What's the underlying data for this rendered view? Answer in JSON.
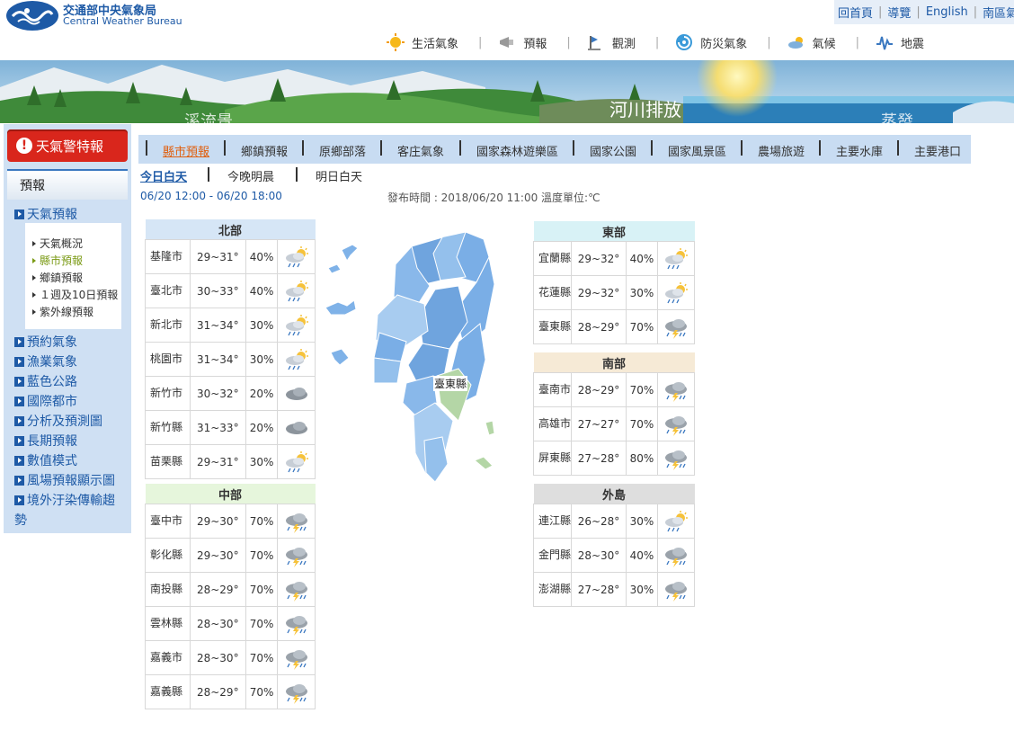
{
  "brand": {
    "cn": "交通部中央氣象局",
    "en": "Central Weather Bureau"
  },
  "top_links": [
    "回首頁",
    "導覽",
    "English",
    "南區氣"
  ],
  "main_nav": [
    {
      "label": "生活氣象",
      "icon": "sun-icon"
    },
    {
      "label": "預報",
      "icon": "megaphone-icon"
    },
    {
      "label": "觀測",
      "icon": "instrument-icon"
    },
    {
      "label": "防災氣象",
      "icon": "typhoon-icon"
    },
    {
      "label": "氣候",
      "icon": "cloud-sun-icon"
    },
    {
      "label": "地震",
      "icon": "seismograph-icon"
    }
  ],
  "banner": {
    "text1": "河川排放",
    "text2": "溪流景",
    "text3": "蒸發"
  },
  "sidebar": {
    "alert": "天氣警特報",
    "heading": "預報",
    "current_section": "天氣預報",
    "sub_items": [
      "天氣概況",
      "縣市預報",
      "鄉鎮預報",
      "１週及10日預報",
      "紫外線預報"
    ],
    "active_sub": "縣市預報",
    "links": [
      "預約氣象",
      "漁業氣象",
      "藍色公路",
      "國際都市",
      "分析及預測圖",
      "長期預報",
      "數值模式",
      "風場預報顯示圖",
      "境外汙染傳輸趨",
      "勢"
    ]
  },
  "tabs": [
    "縣市預報",
    "鄉鎮預報",
    "原鄉部落",
    "客庄氣象",
    "國家森林遊樂區",
    "國家公園",
    "國家風景區",
    "農場旅遊",
    "主要水庫",
    "主要港口"
  ],
  "active_tab": "縣市預報",
  "subtabs": [
    "今日白天",
    "今晚明晨",
    "明日白天"
  ],
  "active_subtab": "今日白天",
  "period": "06/20 12:00 - 06/20 18:00",
  "issued": "發布時間 : 2018/06/20 11:00 溫度單位:℃",
  "map": {
    "hover_label": "臺東縣"
  },
  "regions": {
    "north": {
      "title": "北部",
      "color": "#d6e6f6",
      "rows": [
        {
          "name": "基隆市",
          "temp": "29~31°",
          "pop": "40%",
          "icon": "partly-cloudy-rain-icon"
        },
        {
          "name": "臺北市",
          "temp": "30~33°",
          "pop": "40%",
          "icon": "partly-cloudy-rain-icon"
        },
        {
          "name": "新北市",
          "temp": "31~34°",
          "pop": "30%",
          "icon": "partly-cloudy-rain-icon"
        },
        {
          "name": "桃園市",
          "temp": "31~34°",
          "pop": "30%",
          "icon": "partly-cloudy-rain-icon"
        },
        {
          "name": "新竹市",
          "temp": "30~32°",
          "pop": "20%",
          "icon": "cloudy-icon"
        },
        {
          "name": "新竹縣",
          "temp": "31~33°",
          "pop": "20%",
          "icon": "cloudy-icon"
        },
        {
          "name": "苗栗縣",
          "temp": "29~31°",
          "pop": "30%",
          "icon": "partly-cloudy-rain-icon"
        }
      ]
    },
    "central": {
      "title": "中部",
      "color": "#e6f6dc",
      "rows": [
        {
          "name": "臺中市",
          "temp": "29~30°",
          "pop": "70%",
          "icon": "thunderstorm-icon"
        },
        {
          "name": "彰化縣",
          "temp": "29~30°",
          "pop": "70%",
          "icon": "thunderstorm-icon"
        },
        {
          "name": "南投縣",
          "temp": "28~29°",
          "pop": "70%",
          "icon": "thunderstorm-icon"
        },
        {
          "name": "雲林縣",
          "temp": "28~30°",
          "pop": "70%",
          "icon": "thunderstorm-icon"
        },
        {
          "name": "嘉義市",
          "temp": "28~30°",
          "pop": "70%",
          "icon": "thunderstorm-icon"
        },
        {
          "name": "嘉義縣",
          "temp": "28~29°",
          "pop": "70%",
          "icon": "thunderstorm-icon"
        }
      ]
    },
    "east": {
      "title": "東部",
      "color": "#d8f2f6",
      "rows": [
        {
          "name": "宜蘭縣",
          "temp": "29~32°",
          "pop": "40%",
          "icon": "partly-cloudy-rain-icon"
        },
        {
          "name": "花蓮縣",
          "temp": "29~32°",
          "pop": "30%",
          "icon": "partly-cloudy-rain-icon"
        },
        {
          "name": "臺東縣",
          "temp": "28~29°",
          "pop": "70%",
          "icon": "thunderstorm-icon"
        }
      ]
    },
    "south": {
      "title": "南部",
      "color": "#f6ead6",
      "rows": [
        {
          "name": "臺南市",
          "temp": "28~29°",
          "pop": "70%",
          "icon": "thunderstorm-icon"
        },
        {
          "name": "高雄市",
          "temp": "27~27°",
          "pop": "70%",
          "icon": "thunderstorm-icon"
        },
        {
          "name": "屏東縣",
          "temp": "27~28°",
          "pop": "80%",
          "icon": "thunderstorm-icon"
        }
      ]
    },
    "islands": {
      "title": "外島",
      "color": "#dedede",
      "rows": [
        {
          "name": "連江縣",
          "temp": "26~28°",
          "pop": "30%",
          "icon": "partly-cloudy-rain-icon"
        },
        {
          "name": "金門縣",
          "temp": "28~30°",
          "pop": "40%",
          "icon": "thunderstorm-icon"
        },
        {
          "name": "澎湖縣",
          "temp": "27~28°",
          "pop": "30%",
          "icon": "thunderstorm-icon"
        }
      ]
    }
  }
}
